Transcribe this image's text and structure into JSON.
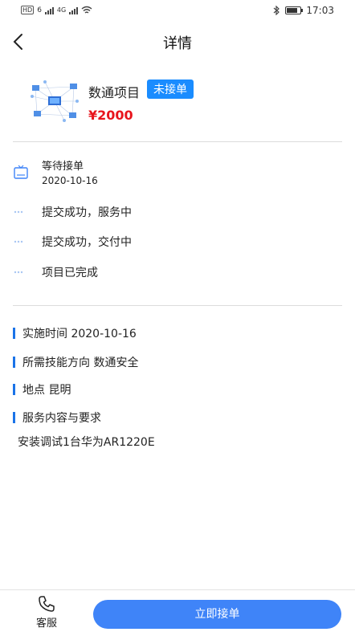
{
  "status_bar": {
    "left_chips": [
      "HD",
      "6",
      "4G"
    ],
    "time": "17:03",
    "battery_level": 0.8
  },
  "nav": {
    "title": "详情",
    "back_icon": "chevron-left-icon"
  },
  "product": {
    "name": "数通项目",
    "status_badge": "未接单",
    "price": "¥2000",
    "price_color": "#e8141c",
    "badge_color": "#1a8cff"
  },
  "timeline": {
    "current": {
      "title": "等待接单",
      "date": "2020-10-16",
      "icon": "monitor-icon"
    },
    "steps": [
      {
        "label": "提交成功，服务中"
      },
      {
        "label": "提交成功，交付中"
      },
      {
        "label": "项目已完成"
      }
    ]
  },
  "details": {
    "time_label": "实施时间",
    "time_value": "2020-10-16",
    "skill_label": "所需技能方向",
    "skill_value": "数通安全",
    "location_label": "地点",
    "location_value": "昆明",
    "content_label": "服务内容与要求",
    "content_value": "安装调试1台华为AR1220E"
  },
  "bottom": {
    "service_label": "客服",
    "service_icon": "phone-icon",
    "accept_label": "立即接单",
    "accent": "#3f84f8"
  }
}
